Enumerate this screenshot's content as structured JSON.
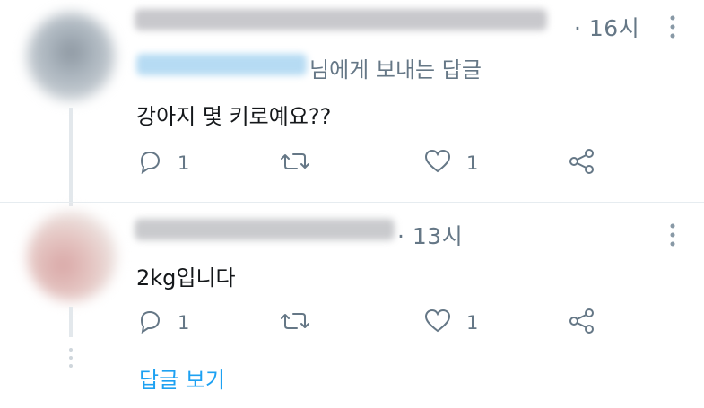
{
  "tweet1": {
    "time": "· 16시",
    "reply_to_suffix": "님에게 보내는 답글",
    "text": "강아지 몇 키로예요??",
    "reply_count": "1",
    "like_count": "1"
  },
  "tweet2": {
    "time": "· 13시",
    "text": "2kg입니다",
    "reply_count": "1",
    "like_count": "1"
  },
  "view_replies": "답글 보기",
  "colors": {
    "accent": "#1da1f2",
    "muted": "#657786",
    "text": "#14171a"
  },
  "icons": [
    "reply-icon",
    "retweet-icon",
    "like-icon",
    "share-icon",
    "more-icon"
  ]
}
